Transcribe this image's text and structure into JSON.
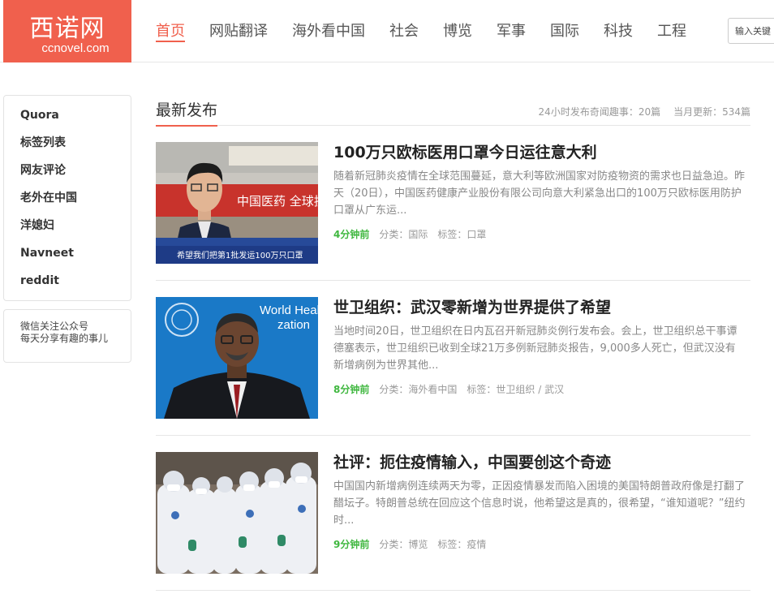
{
  "site": {
    "logo_cn": "西诺网",
    "logo_en": "ccnovel.com",
    "accent": "#f0604d"
  },
  "nav": {
    "items": [
      {
        "label": "首页",
        "active": true
      },
      {
        "label": "网贴翻译"
      },
      {
        "label": "海外看中国"
      },
      {
        "label": "社会"
      },
      {
        "label": "博览"
      },
      {
        "label": "军事"
      },
      {
        "label": "国际"
      },
      {
        "label": "科技"
      },
      {
        "label": "工程"
      }
    ]
  },
  "search": {
    "placeholder": "输入关键"
  },
  "sidebar": {
    "items": [
      {
        "label": "Quora"
      },
      {
        "label": "标签列表"
      },
      {
        "label": "网友评论"
      },
      {
        "label": "老外在中国"
      },
      {
        "label": "洋媳妇"
      },
      {
        "label": "Navneet"
      },
      {
        "label": "reddit"
      }
    ],
    "follow_line1": "微信关注公众号",
    "follow_line2": "每天分享有趣的事儿"
  },
  "section": {
    "title": "最新发布",
    "stat_24h": "24小时发布奇闻趣事：20篇",
    "stat_month": "当月更新：534篇"
  },
  "meta_labels": {
    "category": "分类：",
    "tag": "标签："
  },
  "articles": [
    {
      "title": "100万只欧标医用口罩今日运往意大利",
      "excerpt": "随着新冠肺炎疫情在全球范围蔓延，意大利等欧洲国家对防疫物资的需求也日益急迫。昨天（20日），中国医药健康产业股份有限公司向意大利紧急出口的100万只欧标医用防护口罩从广东运...",
      "time": "4分钟前",
      "category": "国际",
      "tags": "口罩",
      "thumb_caption": "希望我们把第1批发运100万只口罩",
      "thumb_banner": "中国医药  全球抗疫物资"
    },
    {
      "title": "世卫组织：武汉零新增为世界提供了希望",
      "excerpt": "当地时间20日，世卫组织在日内瓦召开新冠肺炎例行发布会。会上，世卫组织总干事谭德塞表示，世卫组织已收到全球21万多例新冠肺炎报告，9,000多人死亡，但武汉没有新增病例为世界其他...",
      "time": "8分钟前",
      "category": "海外看中国",
      "tags": "世卫组织 / 武汉",
      "thumb_caption": "World Health Organization"
    },
    {
      "title": "社评：扼住疫情输入，中国要创这个奇迹",
      "excerpt": "中国国内新增病例连续两天为零，正因疫情暴发而陷入困境的美国特朗普政府像是打翻了醋坛子。特朗普总统在回应这个信息时说，他希望这是真的，很希望，“谁知道呢？”纽约时...",
      "time": "9分钟前",
      "category": "博览",
      "tags": "疫情"
    }
  ]
}
